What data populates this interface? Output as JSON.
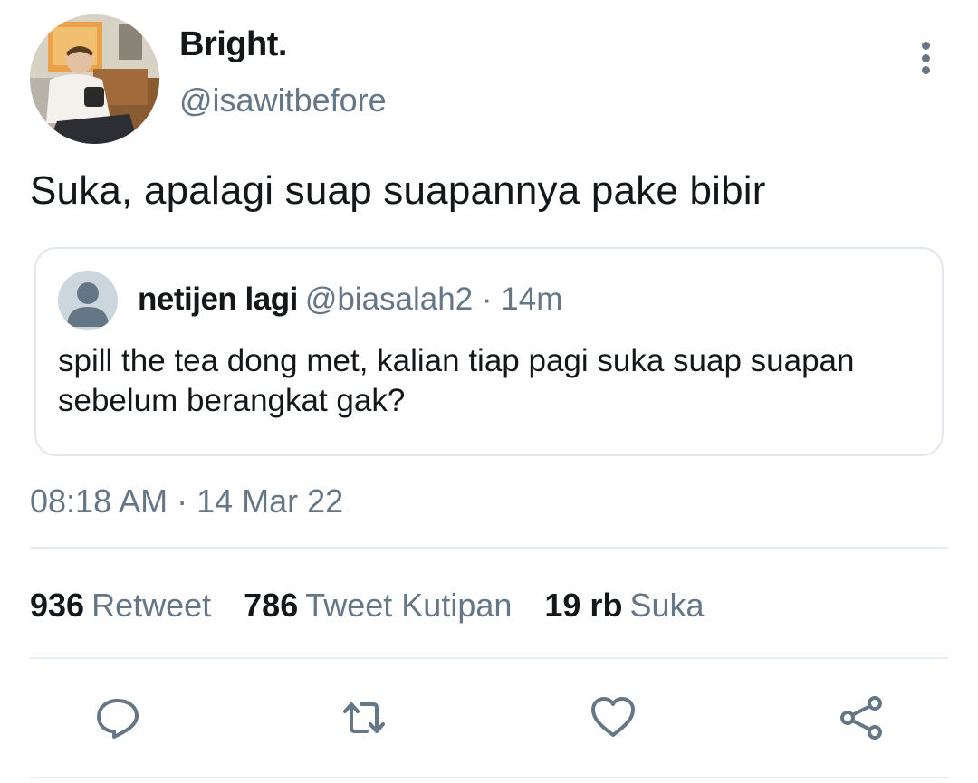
{
  "tweet": {
    "display_name": "Bright.",
    "handle": "@isawitbefore",
    "text": "Suka, apalagi suap suapannya pake bibir",
    "timestamp": "08:18 AM · 14 Mar 22"
  },
  "quoted_tweet": {
    "display_name": "netijen lagi",
    "meta": "@biasalah2 · 14m",
    "text": "spill the tea dong met, kalian tiap pagi suka suap suapan sebelum berangkat gak?"
  },
  "stats": [
    {
      "count": "936",
      "label": "Retweet"
    },
    {
      "count": "786",
      "label": "Tweet Kutipan"
    },
    {
      "count": "19 rb",
      "label": "Suka"
    }
  ],
  "actions": {
    "reply_icon": "reply-icon",
    "retweet_icon": "retweet-icon",
    "like_icon": "heart-icon",
    "share_icon": "share-icon"
  },
  "colors": {
    "text_primary": "#14171a",
    "text_secondary": "#657786",
    "divider": "#e6ecf0"
  }
}
